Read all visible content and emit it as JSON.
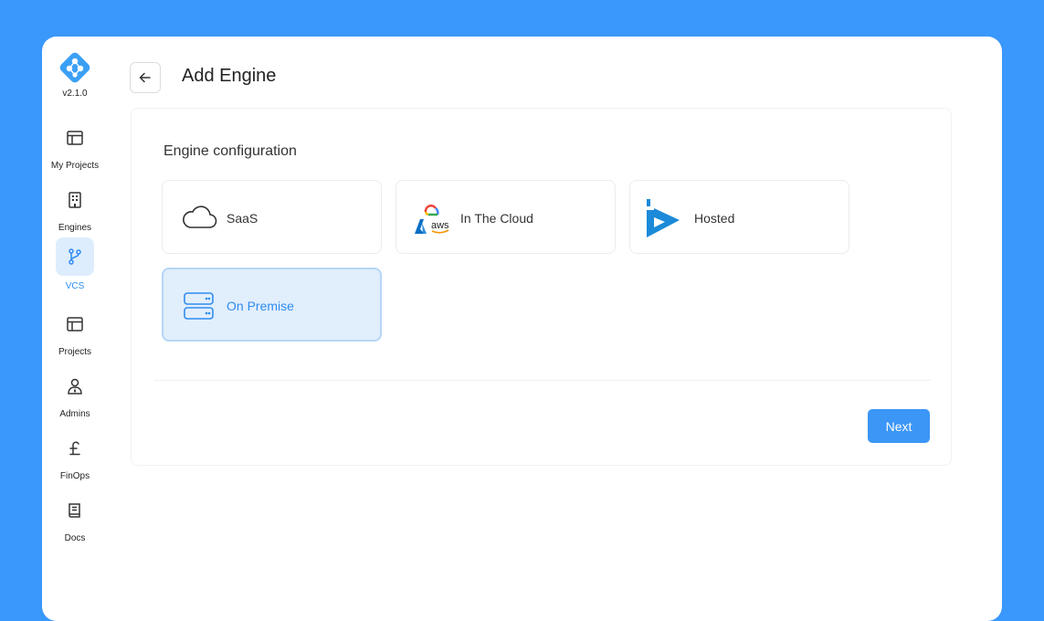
{
  "app": {
    "version": "v2.1.0",
    "brand_color": "#3a97fb"
  },
  "sidebar": {
    "items": [
      {
        "label": "My Projects",
        "icon": "layout-icon",
        "active": false
      },
      {
        "label": "Engines",
        "icon": "building-icon",
        "active": false
      },
      {
        "label": "VCS",
        "icon": "git-branch-icon",
        "active": true
      },
      {
        "label": "Projects",
        "icon": "layout-icon",
        "active": false
      },
      {
        "label": "Admins",
        "icon": "user-admin-icon",
        "active": false
      },
      {
        "label": "FinOps",
        "icon": "pound-icon",
        "active": false
      },
      {
        "label": "Docs",
        "icon": "book-icon",
        "active": false
      }
    ]
  },
  "header": {
    "title": "Add Engine",
    "back_icon": "arrow-left-icon"
  },
  "main": {
    "section_title": "Engine configuration",
    "options": [
      {
        "label": "SaaS",
        "icon": "cloud-icon",
        "selected": false
      },
      {
        "label": "In The Cloud",
        "icon": "cloud-providers-icon",
        "selected": false
      },
      {
        "label": "Hosted",
        "icon": "hosted-logo-icon",
        "selected": false
      },
      {
        "label": "On Premise",
        "icon": "server-icon",
        "selected": true
      }
    ],
    "next_label": "Next"
  }
}
